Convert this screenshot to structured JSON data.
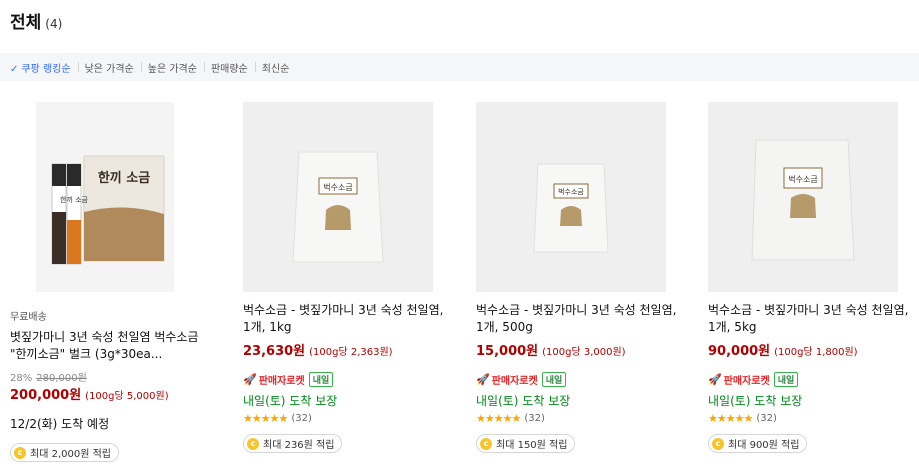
{
  "header": {
    "title": "전체",
    "count": "(4)"
  },
  "sort": {
    "items": [
      {
        "label": "쿠팡 랭킹순",
        "active": true
      },
      {
        "label": "낮은 가격순",
        "active": false
      },
      {
        "label": "높은 가격순",
        "active": false
      },
      {
        "label": "판매량순",
        "active": false
      },
      {
        "label": "최신순",
        "active": false
      }
    ],
    "check_icon": "check-icon"
  },
  "products": [
    {
      "free_shipping": "무료배송",
      "name": "볏짚가마니 3년 숙성 천일염 벅수소금 \"한끼소금\" 벌크 (3g*30ea...",
      "discount_rate": "28%",
      "original_price": "280,000원",
      "price": "200,000원",
      "unit_price": "(100g당 5,000원)",
      "arrival": "12/2(화) 도착 예정",
      "cashback": "최대 2,000원 적립"
    },
    {
      "name": "벅수소금 - 볏짚가마니 3년 숙성 천일염, 1개, 1kg",
      "price": "23,630원",
      "unit_price": "(100g당 2,363원)",
      "rocket": "판매자로켓",
      "rocket_badge": "내일",
      "arrival": "내일(토) 도착 보장",
      "rating_count": "(32)",
      "cashback": "최대 236원 적립"
    },
    {
      "name": "벅수소금 - 볏짚가마니 3년 숙성 천일염, 1개, 500g",
      "price": "15,000원",
      "unit_price": "(100g당 3,000원)",
      "rocket": "판매자로켓",
      "rocket_badge": "내일",
      "arrival": "내일(토) 도착 보장",
      "rating_count": "(32)",
      "cashback": "최대 150원 적립"
    },
    {
      "name": "벅수소금 - 볏짚가마니 3년 숙성 천일염, 1개, 5kg",
      "price": "90,000원",
      "unit_price": "(100g당 1,800원)",
      "rocket": "판매자로켓",
      "rocket_badge": "내일",
      "arrival": "내일(토) 도착 보장",
      "rating_count": "(32)",
      "cashback": "최대 900원 적립"
    }
  ],
  "product_images": {
    "p0_box_title": "한끼 소금",
    "p0_stick_label": "한끼 소금",
    "bag_label": "벅수소금"
  },
  "stars": "★★★★★",
  "colors": {
    "accent": "#346aff",
    "price": "#ae0000",
    "arrival": "#00891a",
    "rocket": "#e52528",
    "star": "#ffa400"
  }
}
